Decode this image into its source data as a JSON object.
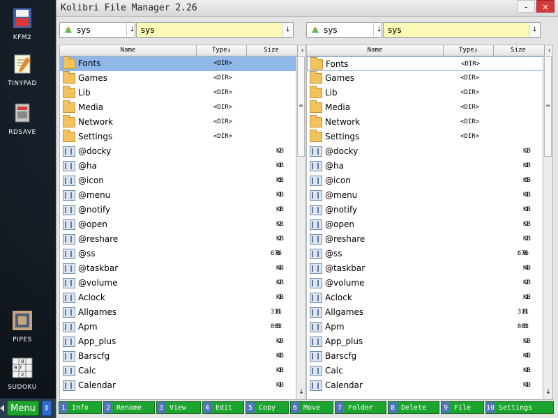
{
  "desktop_icons": [
    "KFM2",
    "TINYPAD",
    "RDSAVE",
    "PIPES",
    "SUDOKU"
  ],
  "taskbar": {
    "menu_label": "Menu"
  },
  "window": {
    "title": "Kolibri File Manager 2.26",
    "minimize_label": "-",
    "close_label": "×"
  },
  "panels": [
    {
      "drive": "sys",
      "path": "sys",
      "columns": {
        "name": "Name",
        "type": "Type↓",
        "size": "Size"
      },
      "rows": [
        {
          "name": "Fonts",
          "type": "<DIR>",
          "size": "",
          "unit": "",
          "folder": true
        },
        {
          "name": "Games",
          "type": "<DIR>",
          "size": "",
          "unit": "",
          "folder": true
        },
        {
          "name": "Lib",
          "type": "<DIR>",
          "size": "",
          "unit": "",
          "folder": true
        },
        {
          "name": "Media",
          "type": "<DIR>",
          "size": "",
          "unit": "",
          "folder": true
        },
        {
          "name": "Network",
          "type": "<DIR>",
          "size": "",
          "unit": "",
          "folder": true
        },
        {
          "name": "Settings",
          "type": "<DIR>",
          "size": "",
          "unit": "",
          "folder": true
        },
        {
          "name": "@docky",
          "type": "",
          "size": "2",
          "unit": "KB",
          "folder": false
        },
        {
          "name": "@ha",
          "type": "",
          "size": "1",
          "unit": "KB",
          "folder": false
        },
        {
          "name": "@icon",
          "type": "",
          "size": "5",
          "unit": "KB",
          "folder": false
        },
        {
          "name": "@menu",
          "type": "",
          "size": "1",
          "unit": "KB",
          "folder": false
        },
        {
          "name": "@notify",
          "type": "",
          "size": "1",
          "unit": "KB",
          "folder": false
        },
        {
          "name": "@open",
          "type": "",
          "size": "2",
          "unit": "KB",
          "folder": false
        },
        {
          "name": "@reshare",
          "type": "",
          "size": "2",
          "unit": "KB",
          "folder": false
        },
        {
          "name": "@ss",
          "type": "",
          "size": "676",
          "unit": "B",
          "folder": false
        },
        {
          "name": "@taskbar",
          "type": "",
          "size": "4",
          "unit": "KB",
          "folder": false
        },
        {
          "name": "@volume",
          "type": "",
          "size": "2",
          "unit": "KB",
          "folder": false
        },
        {
          "name": "Aclock",
          "type": "",
          "size": "1",
          "unit": "KB",
          "folder": false
        },
        {
          "name": "Allgames",
          "type": "",
          "size": "311",
          "unit": "B",
          "folder": false
        },
        {
          "name": "Apm",
          "type": "",
          "size": "803",
          "unit": "B",
          "folder": false
        },
        {
          "name": "App_plus",
          "type": "",
          "size": "2",
          "unit": "KB",
          "folder": false
        },
        {
          "name": "Barscfg",
          "type": "",
          "size": "4",
          "unit": "KB",
          "folder": false
        },
        {
          "name": "Calc",
          "type": "",
          "size": "1",
          "unit": "KB",
          "folder": false
        },
        {
          "name": "Calendar",
          "type": "",
          "size": "1",
          "unit": "KB",
          "folder": false
        }
      ]
    },
    {
      "drive": "sys",
      "path": "sys",
      "columns": {
        "name": "Name",
        "type": "Type↓",
        "size": "Size"
      },
      "rows": [
        {
          "name": "Fonts",
          "type": "<DIR>",
          "size": "",
          "unit": "",
          "folder": true
        },
        {
          "name": "Games",
          "type": "<DIR>",
          "size": "",
          "unit": "",
          "folder": true
        },
        {
          "name": "Lib",
          "type": "<DIR>",
          "size": "",
          "unit": "",
          "folder": true
        },
        {
          "name": "Media",
          "type": "<DIR>",
          "size": "",
          "unit": "",
          "folder": true
        },
        {
          "name": "Network",
          "type": "<DIR>",
          "size": "",
          "unit": "",
          "folder": true
        },
        {
          "name": "Settings",
          "type": "<DIR>",
          "size": "",
          "unit": "",
          "folder": true
        },
        {
          "name": "@docky",
          "type": "",
          "size": "2",
          "unit": "KB",
          "folder": false
        },
        {
          "name": "@ha",
          "type": "",
          "size": "1",
          "unit": "KB",
          "folder": false
        },
        {
          "name": "@icon",
          "type": "",
          "size": "5",
          "unit": "KB",
          "folder": false
        },
        {
          "name": "@menu",
          "type": "",
          "size": "1",
          "unit": "KB",
          "folder": false
        },
        {
          "name": "@notify",
          "type": "",
          "size": "1",
          "unit": "KB",
          "folder": false
        },
        {
          "name": "@open",
          "type": "",
          "size": "2",
          "unit": "KB",
          "folder": false
        },
        {
          "name": "@reshare",
          "type": "",
          "size": "2",
          "unit": "KB",
          "folder": false
        },
        {
          "name": "@ss",
          "type": "",
          "size": "676",
          "unit": "B",
          "folder": false
        },
        {
          "name": "@taskbar",
          "type": "",
          "size": "4",
          "unit": "KB",
          "folder": false
        },
        {
          "name": "@volume",
          "type": "",
          "size": "2",
          "unit": "KB",
          "folder": false
        },
        {
          "name": "Aclock",
          "type": "",
          "size": "1",
          "unit": "KB",
          "folder": false
        },
        {
          "name": "Allgames",
          "type": "",
          "size": "311",
          "unit": "B",
          "folder": false
        },
        {
          "name": "Apm",
          "type": "",
          "size": "803",
          "unit": "B",
          "folder": false
        },
        {
          "name": "App_plus",
          "type": "",
          "size": "2",
          "unit": "KB",
          "folder": false
        },
        {
          "name": "Barscfg",
          "type": "",
          "size": "4",
          "unit": "KB",
          "folder": false
        },
        {
          "name": "Calc",
          "type": "",
          "size": "1",
          "unit": "KB",
          "folder": false
        },
        {
          "name": "Calendar",
          "type": "",
          "size": "1",
          "unit": "KB",
          "folder": false
        }
      ]
    }
  ],
  "function_keys": [
    {
      "num": "1",
      "label": "Info"
    },
    {
      "num": "2",
      "label": "Rename"
    },
    {
      "num": "3",
      "label": "View"
    },
    {
      "num": "4",
      "label": "Edit"
    },
    {
      "num": "5",
      "label": "Copy"
    },
    {
      "num": "6",
      "label": "Move"
    },
    {
      "num": "7",
      "label": "Folder"
    },
    {
      "num": "8",
      "label": "Delete"
    },
    {
      "num": "9",
      "label": "File"
    },
    {
      "num": "10",
      "label": "Settings"
    }
  ]
}
